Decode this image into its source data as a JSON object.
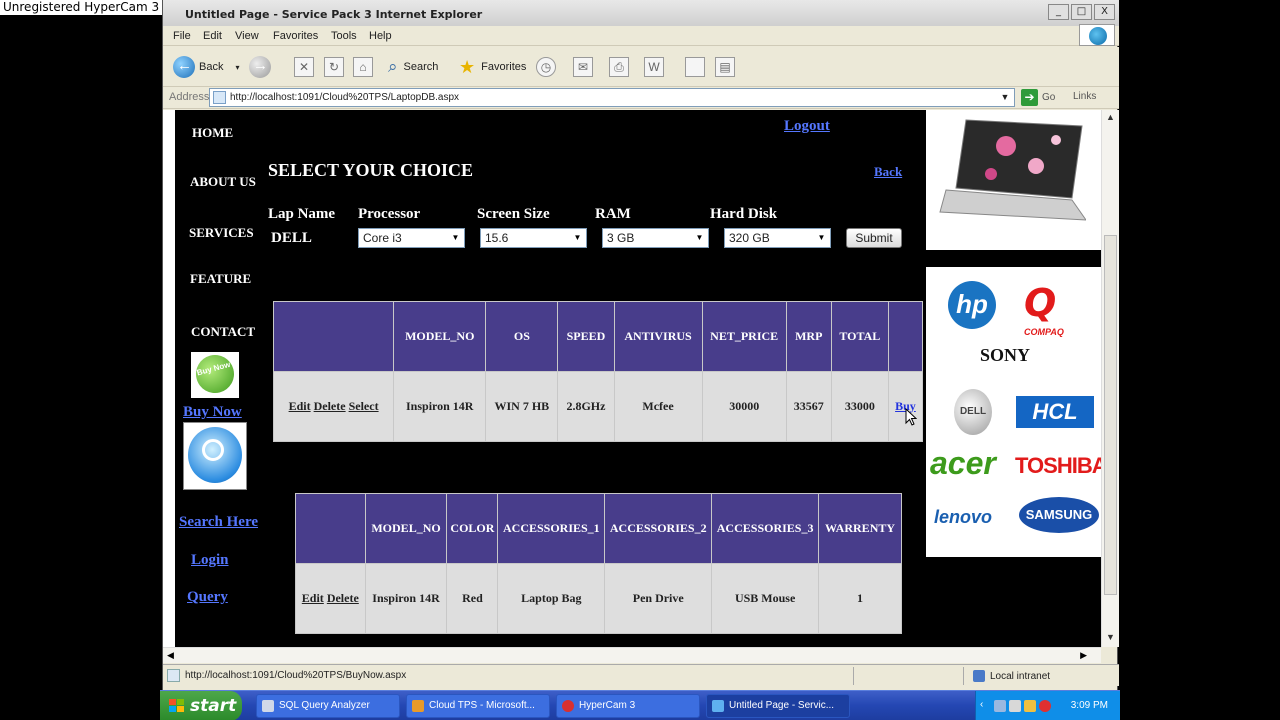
{
  "hypercam": "Unregistered HyperCam 3",
  "window": {
    "title": "Untitled Page - Service Pack 3 Internet Explorer",
    "min": "_",
    "max": "□",
    "close": "X"
  },
  "menu": [
    "File",
    "Edit",
    "View",
    "Favorites",
    "Tools",
    "Help"
  ],
  "toolbar": {
    "back": "Back",
    "search": "Search",
    "favorites": "Favorites"
  },
  "address": {
    "label": "Address",
    "url": "http://localhost:1091/Cloud%20TPS/LaptopDB.aspx",
    "go": "Go",
    "links": "Links"
  },
  "nav": {
    "home": "HOME",
    "about": "ABOUT US",
    "services": "SERVICES",
    "feature": "FEATURE",
    "contact": "CONTACT",
    "buy_now": "Buy Now",
    "search_here": "Search Here",
    "login": "Login",
    "query": "Query",
    "badge": "Buy Now"
  },
  "page": {
    "logout": "Logout",
    "back": "Back",
    "heading": "SELECT YOUR CHOICE",
    "labels": {
      "lap_name": "Lap Name",
      "processor": "Processor",
      "screen": "Screen Size",
      "ram": "RAM",
      "hdd": "Hard Disk"
    },
    "lap_name_value": "DELL",
    "selects": {
      "processor": "Core i3",
      "screen": "15.6",
      "ram": "3 GB",
      "hdd": "320 GB"
    },
    "submit": "Submit"
  },
  "table1": {
    "headers": [
      "",
      "MODEL_NO",
      "OS",
      "SPEED",
      "ANTIVIRUS",
      "NET_PRICE",
      "MRP",
      "TOTAL",
      ""
    ],
    "row": {
      "edit": "Edit",
      "delete": "Delete",
      "select": "Select",
      "model": "Inspiron 14R",
      "os": "WIN 7 HB",
      "speed": "2.8GHz",
      "antivirus": "Mcfee",
      "net_price": "30000",
      "mrp": "33567",
      "total": "33000",
      "buy": "Buy"
    }
  },
  "table2": {
    "headers": [
      "",
      "MODEL_NO",
      "COLOR",
      "ACCESSORIES_1",
      "ACCESSORIES_2",
      "ACCESSORIES_3",
      "WARRENTY"
    ],
    "row": {
      "edit": "Edit",
      "delete": "Delete",
      "model": "Inspiron 14R",
      "color": "Red",
      "acc1": "Laptop Bag",
      "acc2": "Pen Drive",
      "acc3": "USB Mouse",
      "warranty": "1"
    }
  },
  "brands": {
    "hp": "hp",
    "compaq": "COMPAQ",
    "sony": "SONY",
    "dell": "DELL",
    "hcl": "HCL",
    "acer": "acer",
    "toshiba": "TOSHIBA",
    "lenovo": "lenovo",
    "samsung": "SAMSUNG"
  },
  "status": {
    "url": "http://localhost:1091/Cloud%20TPS/BuyNow.aspx",
    "zone": "Local intranet"
  },
  "taskbar": {
    "start": "start",
    "tasks": [
      "SQL Query Analyzer",
      "Cloud TPS - Microsoft...",
      "HyperCam 3",
      "Untitled Page - Servic..."
    ],
    "clock": "3:09 PM"
  },
  "colors": {
    "header_purple": "#483d8b",
    "link_blue": "#5577ff",
    "page_bg": "#000000"
  }
}
